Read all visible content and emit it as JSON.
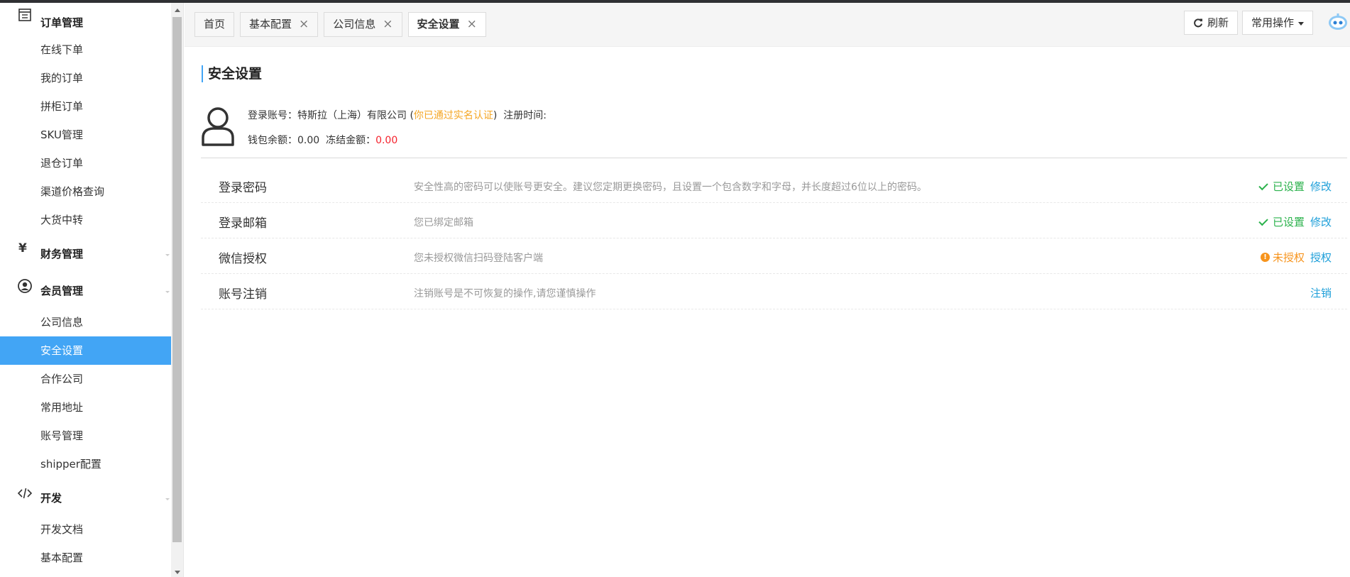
{
  "sidebar": {
    "groups": [
      {
        "label": "订单管理",
        "icon": "order-list-icon",
        "items": [
          "在线下单",
          "我的订单",
          "拼柜订单",
          "SKU管理",
          "退仓订单",
          "渠道价格查询",
          "大货中转"
        ]
      },
      {
        "label": "财务管理",
        "icon": "yen-icon",
        "items": []
      },
      {
        "label": "会员管理",
        "icon": "user-circle-icon",
        "items": [
          "公司信息",
          "安全设置",
          "合作公司",
          "常用地址",
          "账号管理",
          "shipper配置"
        ]
      },
      {
        "label": "开发",
        "icon": "code-icon",
        "items": [
          "开发文档",
          "基本配置"
        ]
      }
    ],
    "active_item": "安全设置",
    "yen_symbol": "¥"
  },
  "tabs": [
    {
      "label": "首页",
      "closable": false
    },
    {
      "label": "基本配置",
      "closable": true
    },
    {
      "label": "公司信息",
      "closable": true
    },
    {
      "label": "安全设置",
      "closable": true,
      "active": true
    }
  ],
  "toolbar": {
    "refresh_label": "刷新",
    "ops_label": "常用操作",
    "close_glyph": "×"
  },
  "page": {
    "title": "安全设置",
    "account_label": "登录账号：",
    "account_value": "特斯拉（上海）有限公司",
    "verified_open": " (",
    "verified_text": "你已通过实名认证",
    "verified_close": ")",
    "register_label": "注册时间:",
    "wallet_label": "钱包余额：",
    "wallet_value": "0.00",
    "frozen_label": "冻结金额：",
    "frozen_value": "0.00"
  },
  "security_rows": [
    {
      "name": "登录密码",
      "desc": "安全性高的密码可以使账号更安全。建议您定期更换密码，且设置一个包含数字和字母，并长度超过6位以上的密码。",
      "status": "已设置",
      "status_type": "ok",
      "action": "修改"
    },
    {
      "name": "登录邮箱",
      "desc": "您已绑定邮箱",
      "status": "已设置",
      "status_type": "ok",
      "action": "修改"
    },
    {
      "name": "微信授权",
      "desc": "您未授权微信扫码登陆客户端",
      "status": "未授权",
      "status_type": "warn",
      "action": "授权"
    },
    {
      "name": "账号注销",
      "desc": "注销账号是不可恢复的操作,请您谨慎操作",
      "status": "",
      "status_type": "none",
      "action": "注销"
    }
  ],
  "colors": {
    "accent": "#42a5f5",
    "ok": "#2bb24c",
    "warn": "#f7941d",
    "link": "#1e9fd9",
    "danger": "#f5222d",
    "verified": "#f5a623"
  }
}
